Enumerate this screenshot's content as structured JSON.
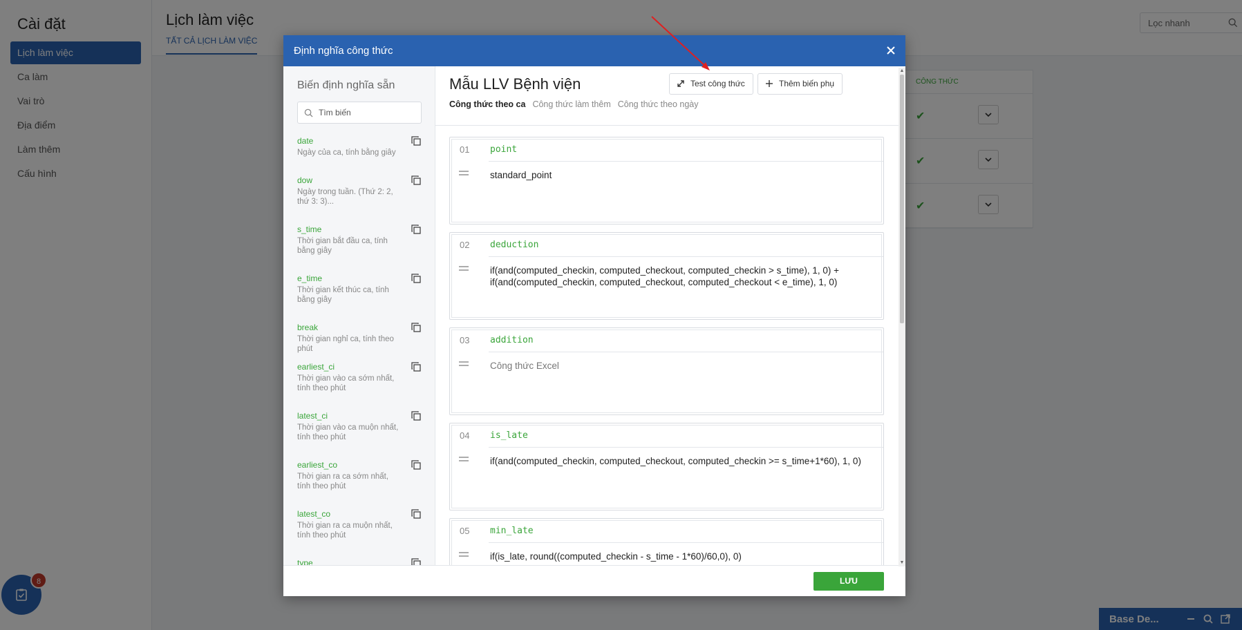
{
  "colors": {
    "primary": "#2a62b0",
    "accent_green": "#3aa53a",
    "badge_red": "#c0392b",
    "annotation_red": "#e02020"
  },
  "sidebar": {
    "title": "Cài đặt",
    "items": [
      {
        "label": "Lịch làm việc",
        "active": true
      },
      {
        "label": "Ca làm"
      },
      {
        "label": "Vai trò"
      },
      {
        "label": "Địa điểm"
      },
      {
        "label": "Làm thêm"
      },
      {
        "label": "Cấu hình"
      }
    ]
  },
  "page": {
    "title": "Lịch làm việc",
    "tab": "TẤT CẢ LỊCH LÀM VIỆC",
    "search_placeholder": "Lọc nhanh",
    "table_header": "CÔNG THỨC",
    "rows": [
      {
        "icon": "check-icon"
      },
      {
        "icon": "check-icon"
      },
      {
        "icon": "check-icon"
      }
    ]
  },
  "task_badge": {
    "count": "8",
    "icon": "task-check-icon"
  },
  "chat_bar": {
    "label": "Base De..."
  },
  "modal": {
    "title": "Định nghĩa công thức",
    "variables": {
      "title": "Biến định nghĩa sẵn",
      "search_placeholder": "Tìm biến",
      "items": [
        {
          "name": "date",
          "desc": "Ngày của ca, tính bằng giây"
        },
        {
          "name": "dow",
          "desc": "Ngày trong tuần. (Thứ 2: 2, thứ 3: 3)..."
        },
        {
          "name": "s_time",
          "desc": "Thời gian bắt đầu ca, tính bằng giây"
        },
        {
          "name": "e_time",
          "desc": "Thời gian kết thúc ca, tính bằng giây"
        },
        {
          "name": "break",
          "desc": "Thời gian nghỉ ca, tính theo phút"
        },
        {
          "name": "earliest_ci",
          "desc": "Thời gian vào ca sớm nhất, tính theo phút"
        },
        {
          "name": "latest_ci",
          "desc": "Thời gian vào ca muộn nhất, tính theo phút"
        },
        {
          "name": "earliest_co",
          "desc": "Thời gian ra ca sớm nhất, tính theo phút"
        },
        {
          "name": "latest_co",
          "desc": "Thời gian ra ca muộn nhất, tính theo phút"
        },
        {
          "name": "type",
          "desc": ""
        }
      ]
    },
    "editor": {
      "title": "Mẫu LLV Bệnh viện",
      "test_button": "Test công thức",
      "add_button": "Thêm biến phụ",
      "tabs": [
        {
          "label": "Công thức theo ca",
          "active": true
        },
        {
          "label": "Công thức làm thêm"
        },
        {
          "label": "Công thức theo ngày"
        }
      ],
      "formulas": [
        {
          "num": "01",
          "name": "point",
          "expr": "standard_point",
          "placeholder": false
        },
        {
          "num": "02",
          "name": "deduction",
          "expr": "if(and(computed_checkin, computed_checkout, computed_checkin > s_time), 1, 0) + if(and(computed_checkin, computed_checkout, computed_checkout < e_time), 1, 0)",
          "placeholder": false
        },
        {
          "num": "03",
          "name": "addition",
          "expr": "Công thức Excel",
          "placeholder": true
        },
        {
          "num": "04",
          "name": "is_late",
          "expr": "if(and(computed_checkin, computed_checkout, computed_checkin >= s_time+1*60), 1, 0)",
          "placeholder": false
        },
        {
          "num": "05",
          "name": "min_late",
          "expr": "if(is_late, round((computed_checkin - s_time - 1*60)/60,0), 0)",
          "placeholder": false
        }
      ]
    },
    "save_button": "LƯU"
  }
}
